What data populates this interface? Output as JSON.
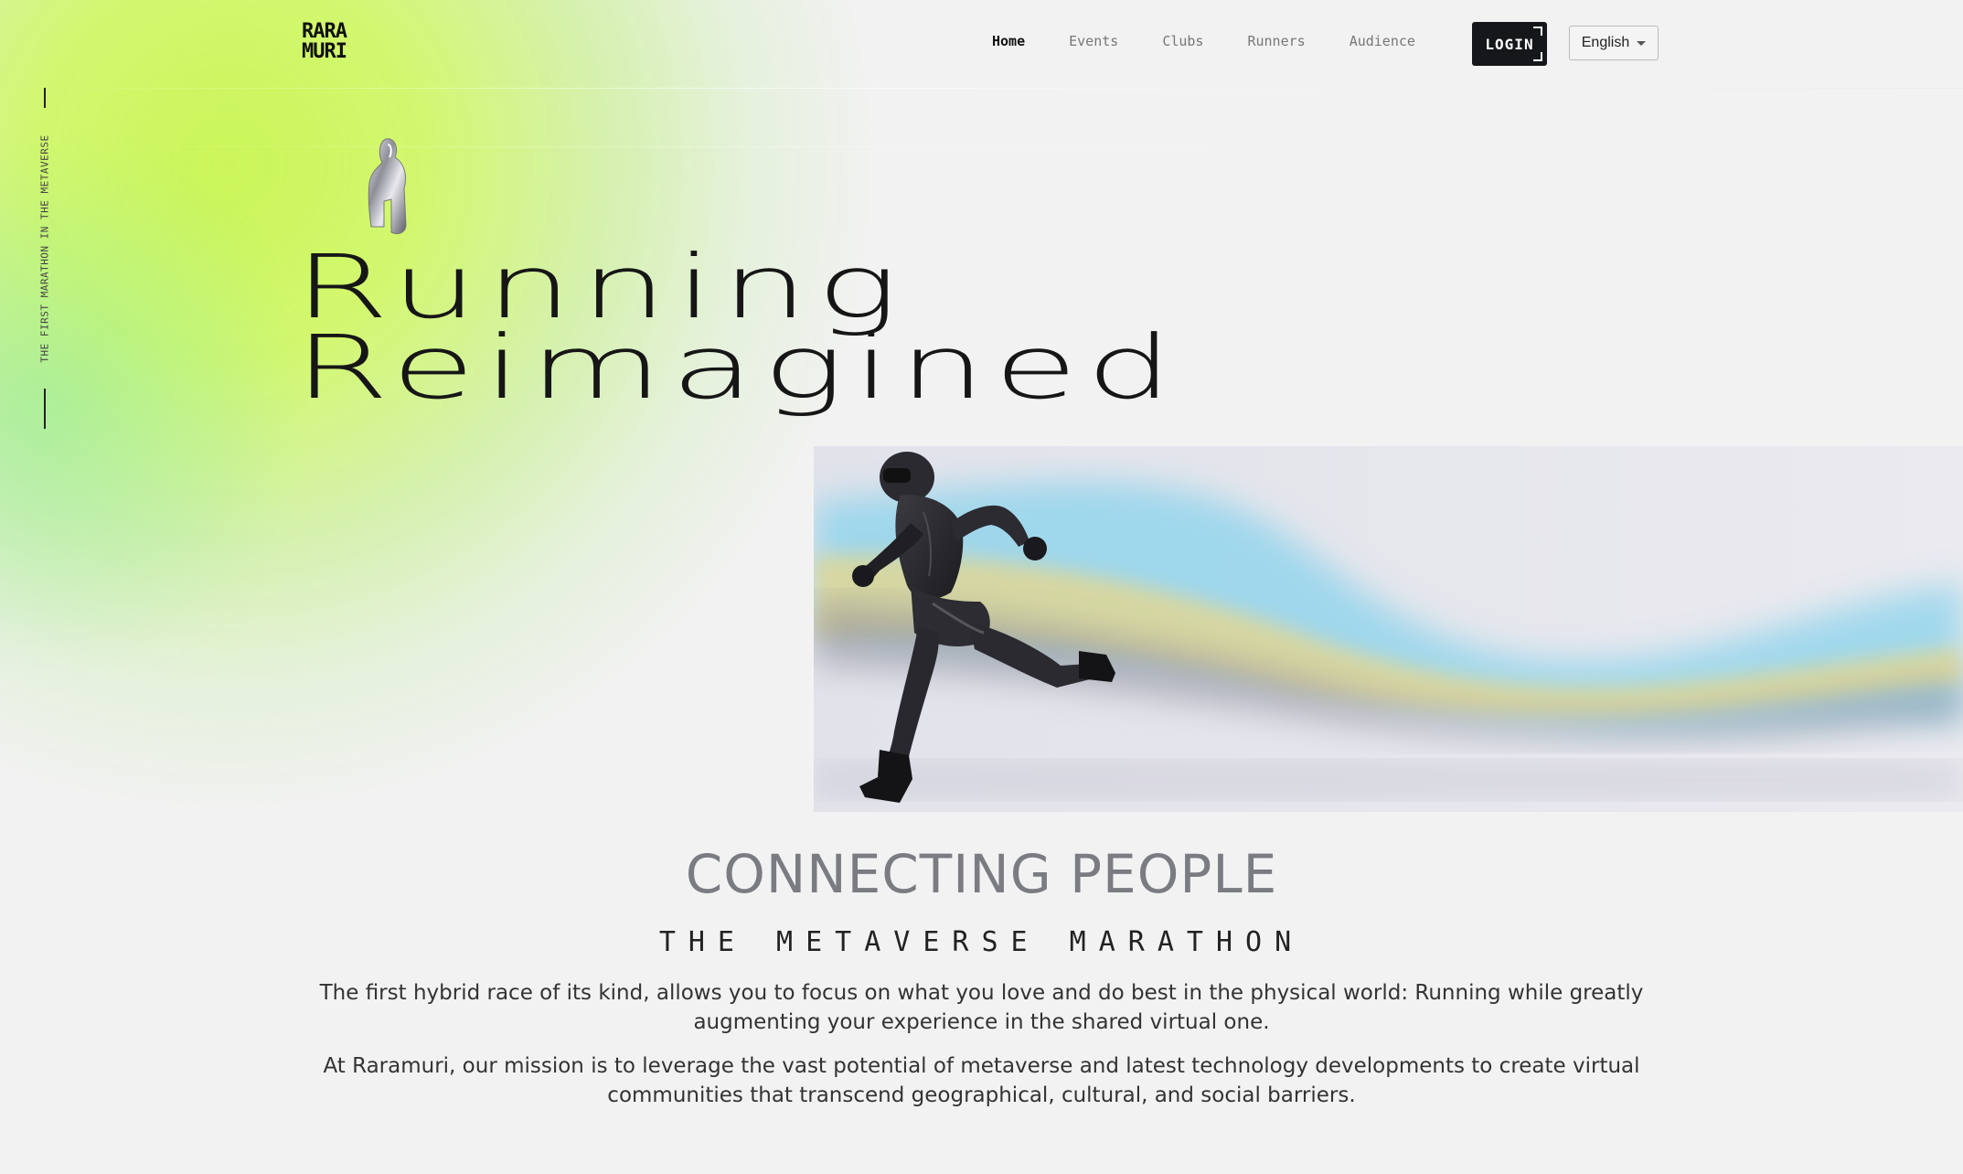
{
  "header": {
    "logo_line1": "RARA",
    "logo_line2": "MURI",
    "nav": [
      {
        "label": "Home",
        "active": true
      },
      {
        "label": "Events",
        "active": false
      },
      {
        "label": "Clubs",
        "active": false
      },
      {
        "label": "Runners",
        "active": false
      },
      {
        "label": "Audience",
        "active": false
      }
    ],
    "login_label": "LOGIN",
    "language": "English"
  },
  "side": {
    "vertical_text": "THE FIRST MARATHON IN THE METAVERSE"
  },
  "hero": {
    "title_line1": "Running",
    "title_line2": "Reimagined",
    "trophy_icon": "trophy-icon",
    "runner_image": "runner-image"
  },
  "section": {
    "title": "CONNECTING PEOPLE",
    "subtitle": "THE METAVERSE MARATHON",
    "paragraph1": "The first hybrid race of its kind, allows you to focus on what you love and do best in the physical world: Running while greatly augmenting your experience in the shared virtual one.",
    "paragraph2": "At Raramuri, our mission is to leverage the vast potential of metaverse and latest technology developments to create virtual communities that transcend geographical, cultural, and social barriers."
  },
  "colors": {
    "accent": "#c8f550",
    "background": "#f2f2f2",
    "button_dark": "#15171a",
    "heading_gray": "#7a7c82"
  }
}
